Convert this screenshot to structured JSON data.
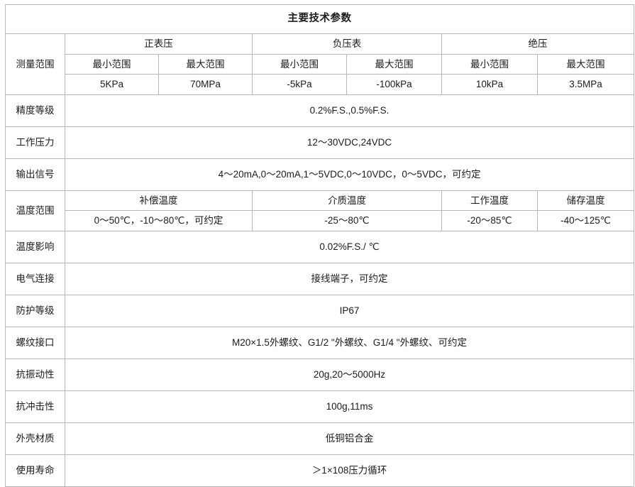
{
  "table": {
    "title": "主要技术参数",
    "measurement": {
      "row_label": "测量范围",
      "groups": [
        {
          "label": "正表压"
        },
        {
          "label": "负压表"
        },
        {
          "label": "绝压"
        }
      ],
      "sub_headers": [
        "最小范围",
        "最大范围",
        "最小范围",
        "最大范围",
        "最小范围",
        "最大范围"
      ],
      "values": [
        "5KPa",
        "70MPa",
        "-5kPa",
        "-100kPa",
        "10kPa",
        "3.5MPa"
      ]
    },
    "simple_rows": [
      {
        "label": "精度等级",
        "value": "0.2%F.S.,0.5%F.S."
      },
      {
        "label": "工作压力",
        "value": "12～30VDC,24VDC"
      },
      {
        "label": "输出信号",
        "value": "4～20mA,0～20mA,1～5VDC,0～10VDC，0～5VDC，可约定"
      }
    ],
    "temperature": {
      "row_label": "温度范围",
      "sub_headers": [
        "补偿温度",
        "介质温度",
        "工作温度",
        "储存温度"
      ],
      "values": [
        "0～50℃，-10～80℃，可约定",
        "-25～80℃",
        "-20～85℃",
        "-40～125℃"
      ]
    },
    "bottom_rows": [
      {
        "label": "温度影响",
        "value": "0.02%F.S./ ℃"
      },
      {
        "label": "电气连接",
        "value": "接线端子，可约定"
      },
      {
        "label": "防护等级",
        "value": "IP67"
      },
      {
        "label": "螺纹接口",
        "value": "M20×1.5外螺纹、G1/2 \"外螺纹、G1/4 \"外螺纹、可约定"
      },
      {
        "label": "抗振动性",
        "value": "20g,20～5000Hz"
      },
      {
        "label": "抗冲击性",
        "value": "100g,11ms"
      },
      {
        "label": "外壳材质",
        "value": "低铜铝合金"
      },
      {
        "label": "使用寿命",
        "value": "＞1×108压力循环"
      }
    ]
  },
  "colors": {
    "border": "#b8b8b8",
    "text": "#1b1b1b",
    "background": "#ffffff"
  }
}
